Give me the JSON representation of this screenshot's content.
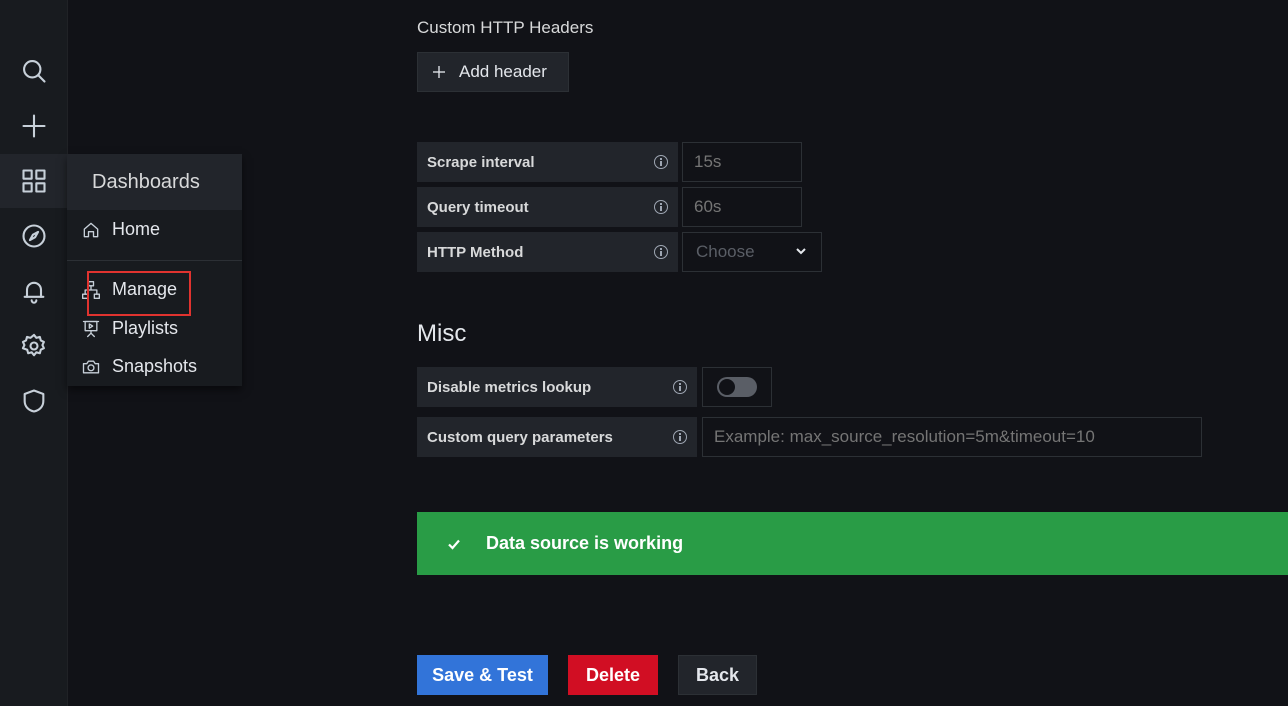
{
  "sidenav": {
    "icons": [
      "search-icon",
      "plus-icon",
      "dashboards-icon",
      "explore-icon",
      "alerting-icon",
      "configuration-icon",
      "shield-icon"
    ]
  },
  "dashboards_menu": {
    "title": "Dashboards",
    "items": [
      {
        "label": "Home",
        "icon": "home-icon"
      },
      {
        "label": "Manage",
        "icon": "sitemap-icon"
      },
      {
        "label": "Playlists",
        "icon": "presentation-icon"
      },
      {
        "label": "Snapshots",
        "icon": "camera-icon"
      }
    ]
  },
  "headers": {
    "section_label": "Custom HTTP Headers",
    "add_label": "Add header"
  },
  "settings": {
    "scrape_interval": {
      "label": "Scrape interval",
      "placeholder": "15s"
    },
    "query_timeout": {
      "label": "Query timeout",
      "placeholder": "60s"
    },
    "http_method": {
      "label": "HTTP Method",
      "value": "Choose"
    }
  },
  "misc": {
    "heading": "Misc",
    "disable_metrics_lookup": {
      "label": "Disable metrics lookup",
      "enabled": false
    },
    "custom_query_parameters": {
      "label": "Custom query parameters",
      "placeholder": "Example: max_source_resolution=5m&timeout=10"
    }
  },
  "status": {
    "message": "Data source is working",
    "color": "#299c46"
  },
  "actions": {
    "save_test": "Save & Test",
    "delete": "Delete",
    "back": "Back"
  },
  "colors": {
    "primary": "#3274d9",
    "danger": "#d10e23",
    "success": "#299c46",
    "highlight": "#e0332f"
  }
}
